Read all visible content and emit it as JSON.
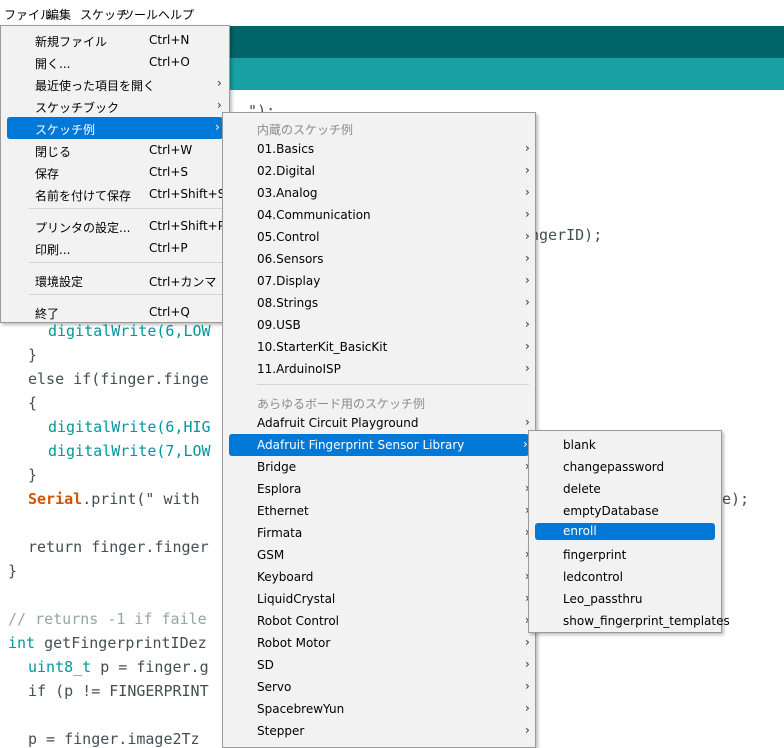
{
  "menubar": {
    "items": [
      "ファイル",
      "編集",
      "スケッチ",
      "ツール",
      "ヘルプ"
    ]
  },
  "colors": {
    "toolbar_dark": "#006468",
    "toolbar_light": "#17a1a5",
    "highlight": "#0078d7",
    "menu_bg": "#f2f2f2"
  },
  "code_lines": {
    "l1": "digitalWrite(6,LOW",
    "l2": "}",
    "l3": "else if(finger.finge",
    "l4": "{",
    "l5": "digitalWrite(6,HIG",
    "l6": "digitalWrite(7,LOW",
    "l7": "}",
    "l8_kw": "Serial",
    "l8_rest": ".print(\" with",
    "l9": "return finger.finger",
    "l10": "}",
    "l11": "// returns -1 if faile",
    "l12_type": "int",
    "l12_rest": " getFingerprintIDez",
    "l13_type": "uint8_t",
    "l13_rest": " p = finger.g",
    "l14": "if (p != FINGERPRINT",
    "l15": "p = finger.image2Tz",
    "right1": "ngerID);",
    "right2": "e);",
    "frag_top": "..\");"
  },
  "file_menu": {
    "items": [
      {
        "label": "新規ファイル",
        "shortcut": "Ctrl+N"
      },
      {
        "label": "開く...",
        "shortcut": "Ctrl+O"
      },
      {
        "label": "最近使った項目を開く",
        "shortcut": ""
      },
      {
        "label": "スケッチブック",
        "shortcut": ""
      },
      {
        "label": "スケッチ例",
        "shortcut": ""
      },
      {
        "label": "閉じる",
        "shortcut": "Ctrl+W"
      },
      {
        "label": "保存",
        "shortcut": "Ctrl+S"
      },
      {
        "label": "名前を付けて保存",
        "shortcut": "Ctrl+Shift+S"
      },
      {
        "label": "プリンタの設定...",
        "shortcut": "Ctrl+Shift+P"
      },
      {
        "label": "印刷...",
        "shortcut": "Ctrl+P"
      },
      {
        "label": "環境設定",
        "shortcut": "Ctrl+カンマ"
      },
      {
        "label": "終了",
        "shortcut": "Ctrl+Q"
      }
    ]
  },
  "examples_menu": {
    "header_builtin": "内蔵のスケッチ例",
    "header_all_boards": "あらゆるボード用のスケッチ例",
    "builtin": [
      "01.Basics",
      "02.Digital",
      "03.Analog",
      "04.Communication",
      "05.Control",
      "06.Sensors",
      "07.Display",
      "08.Strings",
      "09.USB",
      "10.StarterKit_BasicKit",
      "11.ArduinoISP"
    ],
    "libraries": [
      "Adafruit Circuit Playground",
      "Adafruit Fingerprint Sensor Library",
      "Bridge",
      "Esplora",
      "Ethernet",
      "Firmata",
      "GSM",
      "Keyboard",
      "LiquidCrystal",
      "Robot Control",
      "Robot Motor",
      "SD",
      "Servo",
      "SpacebrewYun",
      "Stepper"
    ]
  },
  "fingerprint_menu": {
    "items": [
      "blank",
      "changepassword",
      "delete",
      "emptyDatabase",
      "enroll",
      "fingerprint",
      "ledcontrol",
      "Leo_passthru",
      "show_fingerprint_templates"
    ]
  }
}
